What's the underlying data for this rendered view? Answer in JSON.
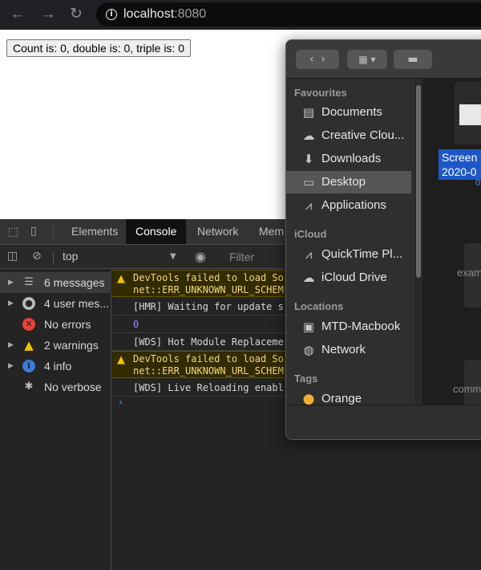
{
  "browser": {
    "url_host": "localhost",
    "url_port": ":8080"
  },
  "page": {
    "counter_button_label": "Count is: 0, double is: 0, triple is: 0"
  },
  "devtools": {
    "tabs": [
      {
        "label": "Elements",
        "active": false
      },
      {
        "label": "Console",
        "active": true
      },
      {
        "label": "Network",
        "active": false
      },
      {
        "label": "Mem",
        "active": false
      }
    ],
    "context": "top",
    "filter_placeholder": "Filter",
    "sidebar": [
      {
        "label": "6 messages",
        "icon": "list-icon",
        "caret": true
      },
      {
        "label": "4 user mes...",
        "icon": "user-icon",
        "caret": true
      },
      {
        "label": "No errors",
        "icon": "error-icon",
        "caret": false
      },
      {
        "label": "2 warnings",
        "icon": "warning-icon",
        "caret": true
      },
      {
        "label": "4 info",
        "icon": "info-icon",
        "caret": true
      },
      {
        "label": "No verbose",
        "icon": "bug-icon",
        "caret": false
      }
    ],
    "console": {
      "warn1_line1": "DevTools failed to load So",
      "warn1_line2": "net::ERR_UNKNOWN_URL_SCHEM",
      "hmr": "[HMR] Waiting for update s",
      "zero": "0",
      "wds1": "[WDS] Hot Module Replaceme",
      "warn2_line1": "DevTools failed to load So",
      "warn2_line2": "net::ERR_UNKNOWN_URL_SCHEM",
      "wds2": "[WDS] Live Reloading enabl",
      "prompt": "›"
    }
  },
  "finder": {
    "sections": {
      "favourites": "Favourites",
      "icloud": "iCloud",
      "locations": "Locations",
      "tags": "Tags"
    },
    "favourites": [
      {
        "label": "Documents",
        "icon": "document-icon"
      },
      {
        "label": "Creative Clou...",
        "icon": "creative-cloud-icon"
      },
      {
        "label": "Downloads",
        "icon": "download-icon"
      },
      {
        "label": "Desktop",
        "icon": "desktop-icon",
        "selected": true
      },
      {
        "label": "Applications",
        "icon": "applications-icon"
      }
    ],
    "icloud": [
      {
        "label": "QuickTime Pl...",
        "icon": "applications-icon"
      },
      {
        "label": "iCloud Drive",
        "icon": "cloud-icon"
      }
    ],
    "locations": [
      {
        "label": "MTD-Macbook",
        "icon": "disk-icon"
      },
      {
        "label": "Network",
        "icon": "network-icon"
      }
    ],
    "tags": [
      {
        "label": "Orange",
        "color": "#f0b030"
      }
    ],
    "files": {
      "selected_label": "Screen\n2020-0",
      "selected_sub": "0",
      "file2": "exam",
      "file3": "comm"
    }
  }
}
